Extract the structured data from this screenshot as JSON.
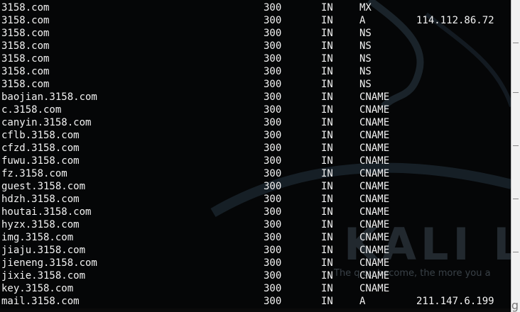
{
  "wallpaper": {
    "brand": "KALI LINU",
    "tagline": "The q      ou become, the more you a"
  },
  "records": [
    {
      "name": "3158.com",
      "ttl": "300",
      "class": "IN",
      "type": "MX",
      "data": ""
    },
    {
      "name": "3158.com",
      "ttl": "300",
      "class": "IN",
      "type": "A",
      "data": "114.112.86.72"
    },
    {
      "name": "3158.com",
      "ttl": "300",
      "class": "IN",
      "type": "NS",
      "data": ""
    },
    {
      "name": "3158.com",
      "ttl": "300",
      "class": "IN",
      "type": "NS",
      "data": ""
    },
    {
      "name": "3158.com",
      "ttl": "300",
      "class": "IN",
      "type": "NS",
      "data": ""
    },
    {
      "name": "3158.com",
      "ttl": "300",
      "class": "IN",
      "type": "NS",
      "data": ""
    },
    {
      "name": "3158.com",
      "ttl": "300",
      "class": "IN",
      "type": "NS",
      "data": ""
    },
    {
      "name": "baojian.3158.com",
      "ttl": "300",
      "class": "IN",
      "type": "CNAME",
      "data": ""
    },
    {
      "name": "c.3158.com",
      "ttl": "300",
      "class": "IN",
      "type": "CNAME",
      "data": ""
    },
    {
      "name": "canyin.3158.com",
      "ttl": "300",
      "class": "IN",
      "type": "CNAME",
      "data": ""
    },
    {
      "name": "cflb.3158.com",
      "ttl": "300",
      "class": "IN",
      "type": "CNAME",
      "data": ""
    },
    {
      "name": "cfzd.3158.com",
      "ttl": "300",
      "class": "IN",
      "type": "CNAME",
      "data": ""
    },
    {
      "name": "fuwu.3158.com",
      "ttl": "300",
      "class": "IN",
      "type": "CNAME",
      "data": ""
    },
    {
      "name": "fz.3158.com",
      "ttl": "300",
      "class": "IN",
      "type": "CNAME",
      "data": ""
    },
    {
      "name": "guest.3158.com",
      "ttl": "300",
      "class": "IN",
      "type": "CNAME",
      "data": ""
    },
    {
      "name": "hdzh.3158.com",
      "ttl": "300",
      "class": "IN",
      "type": "CNAME",
      "data": ""
    },
    {
      "name": "houtai.3158.com",
      "ttl": "300",
      "class": "IN",
      "type": "CNAME",
      "data": ""
    },
    {
      "name": "hyzx.3158.com",
      "ttl": "300",
      "class": "IN",
      "type": "CNAME",
      "data": ""
    },
    {
      "name": "img.3158.com",
      "ttl": "300",
      "class": "IN",
      "type": "CNAME",
      "data": ""
    },
    {
      "name": "jiaju.3158.com",
      "ttl": "300",
      "class": "IN",
      "type": "CNAME",
      "data": ""
    },
    {
      "name": "jieneng.3158.com",
      "ttl": "300",
      "class": "IN",
      "type": "CNAME",
      "data": ""
    },
    {
      "name": "jixie.3158.com",
      "ttl": "300",
      "class": "IN",
      "type": "CNAME",
      "data": ""
    },
    {
      "name": "key.3158.com",
      "ttl": "300",
      "class": "IN",
      "type": "CNAME",
      "data": ""
    },
    {
      "name": "mail.3158.com",
      "ttl": "300",
      "class": "IN",
      "type": "A",
      "data": "211.147.6.199"
    }
  ],
  "tray": {
    "glyph": "g"
  },
  "colors": {
    "terminal_bg": "#050607",
    "text": "#f2f2f2",
    "wallpaper_brand": "#3b4651"
  }
}
